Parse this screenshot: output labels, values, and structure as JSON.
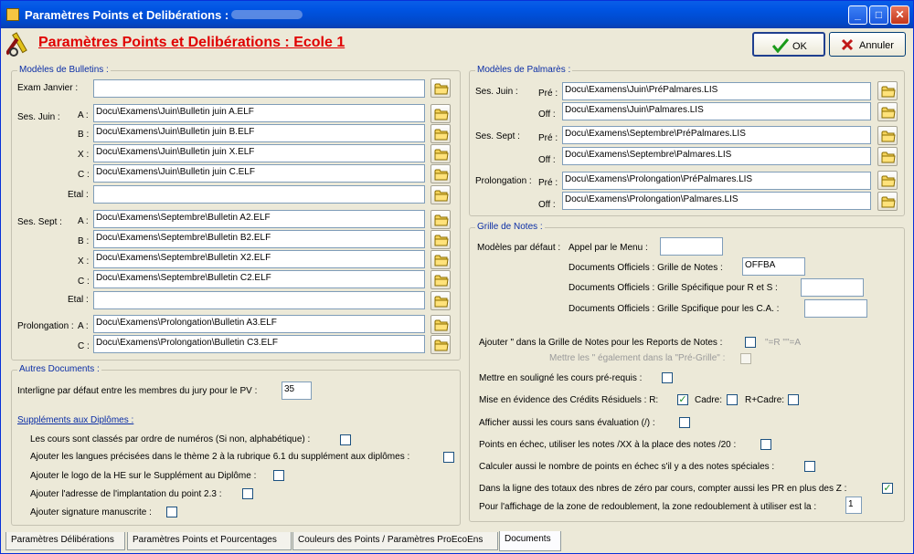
{
  "window": {
    "title": "Paramètres Points et Delibérations :"
  },
  "header": {
    "title": "Paramètres Points et Delibérations : Ecole 1",
    "ok_label": "OK",
    "cancel_label": "Annuler"
  },
  "bulletins": {
    "legend": "Modèles de Bulletins :",
    "exam_janvier": {
      "label": "Exam Janvier :",
      "value": ""
    },
    "juin": {
      "label": "Ses. Juin :",
      "rows": [
        {
          "key": "A :",
          "value": "Docu\\Examens\\Juin\\Bulletin juin A.ELF"
        },
        {
          "key": "B :",
          "value": "Docu\\Examens\\Juin\\Bulletin juin B.ELF"
        },
        {
          "key": "X :",
          "value": "Docu\\Examens\\Juin\\Bulletin juin X.ELF"
        },
        {
          "key": "C :",
          "value": "Docu\\Examens\\Juin\\Bulletin juin C.ELF"
        },
        {
          "key": "Etal :",
          "value": ""
        }
      ]
    },
    "sept": {
      "label": "Ses. Sept :",
      "rows": [
        {
          "key": "A :",
          "value": "Docu\\Examens\\Septembre\\Bulletin A2.ELF"
        },
        {
          "key": "B :",
          "value": "Docu\\Examens\\Septembre\\Bulletin B2.ELF"
        },
        {
          "key": "X :",
          "value": "Docu\\Examens\\Septembre\\Bulletin X2.ELF"
        },
        {
          "key": "C :",
          "value": "Docu\\Examens\\Septembre\\Bulletin C2.ELF"
        },
        {
          "key": "Etal :",
          "value": ""
        }
      ]
    },
    "prolong": {
      "label": "Prolongation :",
      "rows": [
        {
          "key": "A :",
          "value": "Docu\\Examens\\Prolongation\\Bulletin A3.ELF"
        },
        {
          "key": "C :",
          "value": "Docu\\Examens\\Prolongation\\Bulletin C3.ELF"
        }
      ]
    }
  },
  "autres": {
    "legend": "Autres Documents :",
    "interligne_label": "Interligne par défaut entre les membres du jury pour le PV :",
    "interligne_value": "35",
    "supplements_title": "Suppléments aux Diplômes :",
    "checks": [
      {
        "label": "Les cours sont classés par ordre de numéros (Si non, alphabétique) :",
        "checked": false
      },
      {
        "label": "Ajouter les langues précisées dans le thème 2 à la rubrique 6.1 du supplément aux diplômes :",
        "checked": false
      },
      {
        "label": "Ajouter le logo de la HE sur le Supplément au Diplôme :",
        "checked": false
      },
      {
        "label": "Ajouter l'adresse de l'implantation du point 2.3 :",
        "checked": false
      },
      {
        "label": "Ajouter signature manuscrite :",
        "checked": false
      }
    ]
  },
  "palmares": {
    "legend": "Modèles de Palmarès :",
    "pre": "Pré :",
    "off": "Off :",
    "groups": [
      {
        "label": "Ses. Juin :",
        "pre": "Docu\\Examens\\Juin\\PréPalmares.LIS",
        "off": "Docu\\Examens\\Juin\\Palmares.LIS"
      },
      {
        "label": "Ses. Sept :",
        "pre": "Docu\\Examens\\Septembre\\PréPalmares.LIS",
        "off": "Docu\\Examens\\Septembre\\Palmares.LIS"
      },
      {
        "label": "Prolongation :",
        "pre": "Docu\\Examens\\Prolongation\\PréPalmares.LIS",
        "off": "Docu\\Examens\\Prolongation\\Palmares.LIS"
      }
    ]
  },
  "grille": {
    "legend": "Grille de Notes :",
    "modeles_label": "Modèles par défaut :",
    "appel_label": "Appel par le Menu :",
    "appel_value": "",
    "docs_grille_label": "Documents Officiels : Grille de Notes :",
    "docs_grille_value": "OFFBA",
    "docs_rs_label": "Documents Officiels : Grille Spécifique pour R et S :",
    "docs_rs_value": "",
    "docs_ca_label": "Documents Officiels : Grille Spcifique pour les C.A. :",
    "docs_ca_value": "",
    "ajouter_label": "Ajouter \" dans la Grille de Notes pour les Reports de Notes :",
    "ajouter_hint": "\"=R \"\"=A",
    "mettre_label": "Mettre les \" également dans la \"Pré-Grille\" :",
    "souligne_label": "Mettre en souligné les cours pré-requis :",
    "residuels_label": "Mise en évidence des Crédits Résiduels : R:",
    "cadre_label": "Cadre:",
    "rcadre_label": "R+Cadre:",
    "sans_eval_label": "Afficher aussi les cours sans évaluation (/) :",
    "echec_label": "Points en échec, utiliser les notes /XX à la place des notes /20 :",
    "calculer_label": "Calculer aussi le nombre de points en échec s'il y a des notes spéciales :",
    "totaux_label": "Dans la ligne des totaux des nbres de zéro par cours, compter aussi les PR en plus des Z :",
    "redoublement_label": "Pour l'affichage de la zone de redoublement, la zone redoublement à utiliser est la :",
    "redoublement_value": "1"
  },
  "tabs": [
    "Paramètres Délibérations",
    "Paramètres Points et Pourcentages",
    "Couleurs des Points / Paramètres ProEcoEns",
    "Documents"
  ],
  "active_tab": "Documents"
}
